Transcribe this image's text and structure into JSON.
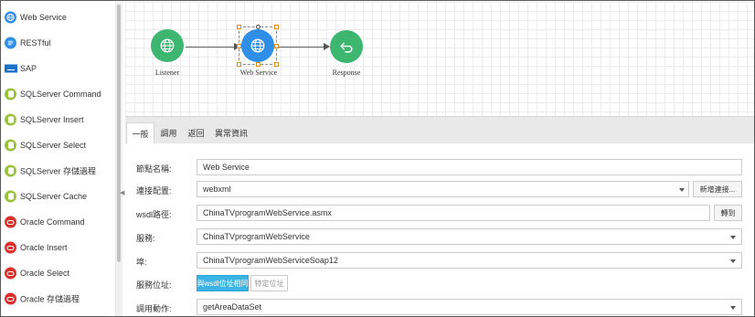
{
  "sidebar": {
    "items": [
      {
        "label": "Web Service",
        "icon": "globe-icon",
        "color": "#2f8ee6"
      },
      {
        "label": "RESTful",
        "icon": "rest-icon",
        "color": "#2f8ee6"
      },
      {
        "label": "SAP",
        "icon": "sap-logo-icon",
        "color": "#1a73c8"
      },
      {
        "label": "SQLServer Command",
        "icon": "database-icon",
        "color": "#9bc23c"
      },
      {
        "label": "SQLServer Insert",
        "icon": "database-icon",
        "color": "#9bc23c"
      },
      {
        "label": "SQLServer Select",
        "icon": "database-icon",
        "color": "#9bc23c"
      },
      {
        "label": "SQLServer 存儲過程",
        "icon": "database-icon",
        "color": "#9bc23c"
      },
      {
        "label": "SQLServer Cache",
        "icon": "database-icon",
        "color": "#9bc23c"
      },
      {
        "label": "Oracle Command",
        "icon": "oracle-icon",
        "color": "#d9302c"
      },
      {
        "label": "Oracle Insert",
        "icon": "oracle-icon",
        "color": "#d9302c"
      },
      {
        "label": "Oracle Select",
        "icon": "oracle-icon",
        "color": "#d9302c"
      },
      {
        "label": "Oracle 存儲過程",
        "icon": "oracle-icon",
        "color": "#d9302c"
      }
    ]
  },
  "flow": {
    "nodes": [
      {
        "label": "Listener",
        "icon": "globe-icon",
        "color": "#3db670"
      },
      {
        "label": "Web Service",
        "icon": "globe-icon",
        "color": "#2f8ee6",
        "selected": true
      },
      {
        "label": "Response",
        "icon": "return-arrow-icon",
        "color": "#3db670"
      }
    ]
  },
  "tabs": [
    {
      "label": "一般",
      "active": true
    },
    {
      "label": "調用",
      "active": false
    },
    {
      "label": "返回",
      "active": false
    },
    {
      "label": "異常資訊",
      "active": false
    }
  ],
  "form": {
    "node_name": {
      "label": "節點名稱:",
      "value": "Web Service"
    },
    "connection": {
      "label": "連接配置:",
      "value": "webxml",
      "new_button": "新增連接..."
    },
    "wsdl": {
      "label": "wsdl路徑:",
      "value": "ChinaTVprogramWebService.asmx",
      "goto_button": "轉到"
    },
    "service": {
      "label": "服務:",
      "value": "ChinaTVprogramWebService"
    },
    "port": {
      "label": "埠:",
      "value": "ChinaTVprogramWebServiceSoap12"
    },
    "service_address": {
      "label": "服務位址:",
      "option_wsdl": "與wsdl位址相同",
      "option_specific": "特定位址"
    },
    "operation": {
      "label": "調用動作:",
      "value": "getAreaDataSet"
    }
  },
  "colors": {
    "accent_blue": "#3bb4e5",
    "node_green": "#3db670",
    "node_blue": "#2f8ee6"
  }
}
